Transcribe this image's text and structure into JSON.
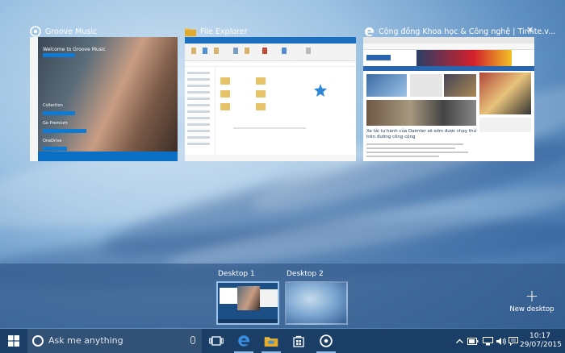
{
  "windows": [
    {
      "title": "Groove Music",
      "icon": "groove-music-icon"
    },
    {
      "title": "File Explorer",
      "icon": "folder-icon"
    },
    {
      "title": "Cộng đồng Khoa học & Công nghệ | Tinhte.v...",
      "icon": "edge-icon"
    }
  ],
  "groove": {
    "welcome": "Welcome to Groove Music",
    "collection": "Collection",
    "go_premium": "Go Premium",
    "onedrive": "OneDrive"
  },
  "edge_article": "Xe tải tự hành của Daimler sẽ sớm được chạy thử trên đường công cộng",
  "desktops": [
    {
      "label": "Desktop 1",
      "active": true
    },
    {
      "label": "Desktop 2",
      "active": false
    }
  ],
  "new_desktop_label": "New desktop",
  "taskbar": {
    "search_placeholder": "Ask me anything",
    "apps": [
      "task-view-icon",
      "edge-icon",
      "folder-icon",
      "store-icon",
      "groove-music-icon"
    ]
  },
  "clock": {
    "time": "10:17",
    "date": "29/07/2015"
  },
  "colors": {
    "accent": "#0b6fc6",
    "taskbar": "#1a3e66",
    "desktops_bar": "#345c8a"
  }
}
